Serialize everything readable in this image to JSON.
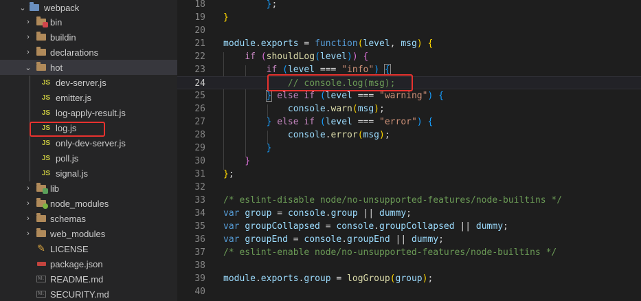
{
  "explorer": {
    "root": {
      "label": "webpack",
      "expanded": true
    },
    "items": [
      {
        "label": "bin",
        "type": "folder",
        "expanded": false
      },
      {
        "label": "buildin",
        "type": "folder",
        "expanded": false
      },
      {
        "label": "declarations",
        "type": "folder",
        "expanded": false
      },
      {
        "label": "hot",
        "type": "folder",
        "expanded": true
      },
      {
        "label": "dev-server.js",
        "type": "js"
      },
      {
        "label": "emitter.js",
        "type": "js"
      },
      {
        "label": "log-apply-result.js",
        "type": "js"
      },
      {
        "label": "log.js",
        "type": "js"
      },
      {
        "label": "only-dev-server.js",
        "type": "js"
      },
      {
        "label": "poll.js",
        "type": "js"
      },
      {
        "label": "signal.js",
        "type": "js"
      },
      {
        "label": "lib",
        "type": "folder",
        "expanded": false
      },
      {
        "label": "node_modules",
        "type": "folder",
        "expanded": false
      },
      {
        "label": "schemas",
        "type": "folder",
        "expanded": false
      },
      {
        "label": "web_modules",
        "type": "folder",
        "expanded": false
      },
      {
        "label": "LICENSE",
        "type": "license"
      },
      {
        "label": "package.json",
        "type": "package"
      },
      {
        "label": "README.md",
        "type": "md"
      },
      {
        "label": "SECURITY.md",
        "type": "md"
      }
    ],
    "js_icon_text": "JS",
    "md_icon_text": "M↓"
  },
  "editor": {
    "current_line": "24",
    "line_numbers": [
      "18",
      "19",
      "20",
      "21",
      "22",
      "23",
      "24",
      "25",
      "26",
      "27",
      "28",
      "29",
      "30",
      "31",
      "32",
      "33",
      "34",
      "35",
      "36",
      "37",
      "38",
      "39",
      "40"
    ]
  },
  "colors": {
    "highlight_box": "#e8322f",
    "keyword": "#569cd6",
    "function": "#dcdcaa",
    "variable": "#9cdcfe",
    "string": "#ce9178",
    "comment": "#6a9955"
  }
}
